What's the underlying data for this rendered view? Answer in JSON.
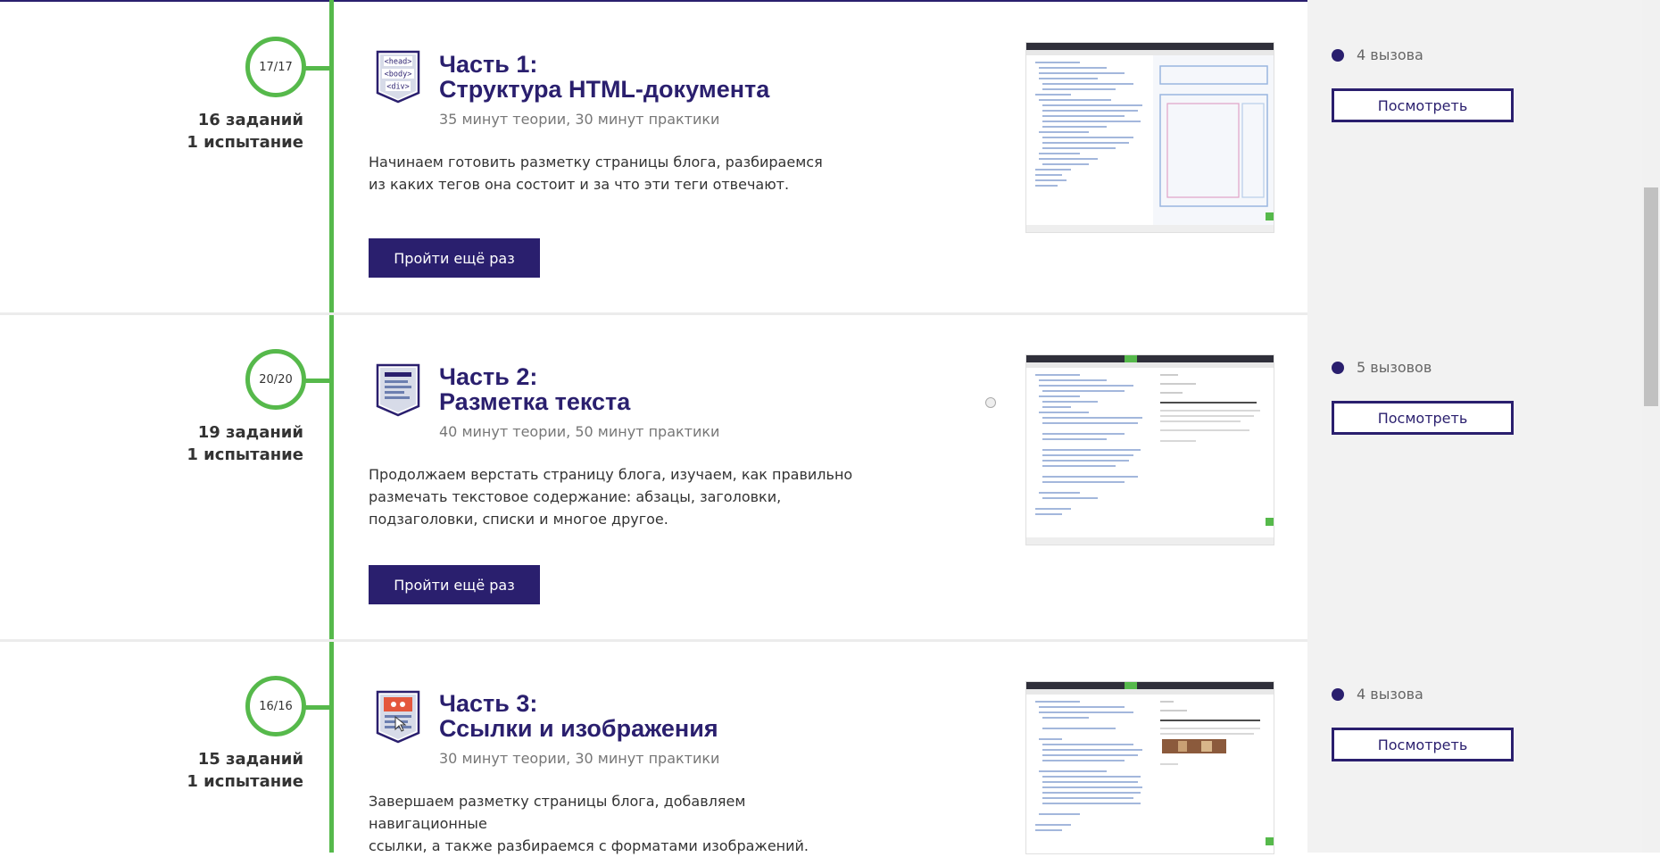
{
  "colors": {
    "accent": "#2a1f6e",
    "timeline": "#56b94b",
    "side_panel": "#f2f2f2"
  },
  "parts": [
    {
      "progress": "17/17",
      "tasks": "16 заданий",
      "tests": "1 испытание",
      "icon": "html-tags-icon",
      "icon_lines": [
        "<head>",
        "<body>",
        "<div>"
      ],
      "title_line1": "Часть 1:",
      "title_line2": "Структура HTML-документа",
      "duration": "35 минут теории, 30 минут практики",
      "desc_line1": "Начинаем готовить разметку страницы блога, разбираемся",
      "desc_line2": "из каких тегов она состоит и за что эти теги отвечают.",
      "button": "Пройти ещё раз",
      "challenges": "4 вызова",
      "view_button": "Посмотреть"
    },
    {
      "progress": "20/20",
      "tasks": "19 заданий",
      "tests": "1 испытание",
      "icon": "text-document-icon",
      "title_line1": "Часть 2:",
      "title_line2": "Разметка текста",
      "duration": "40 минут теории, 50 минут практики",
      "desc_line1": "Продолжаем верстать страницу блога, изучаем, как правильно",
      "desc_line2": "размечать текстовое содержание: абзацы, заголовки,",
      "desc_line3": "подзаголовки, списки и многое другое.",
      "button": "Пройти ещё раз",
      "challenges": "5 вызовов",
      "view_button": "Посмотреть"
    },
    {
      "progress": "16/16",
      "tasks": "15 заданий",
      "tests": "1 испытание",
      "icon": "image-link-icon",
      "title_line1": "Часть 3:",
      "title_line2": "Ссылки и изображения",
      "duration": "30 минут теории, 30 минут практики",
      "desc_line1": "Завершаем разметку страницы блога, добавляем навигационные",
      "desc_line2": "ссылки, а также разбираемся с форматами изображений.",
      "challenges": "4 вызова",
      "view_button": "Посмотреть"
    }
  ]
}
